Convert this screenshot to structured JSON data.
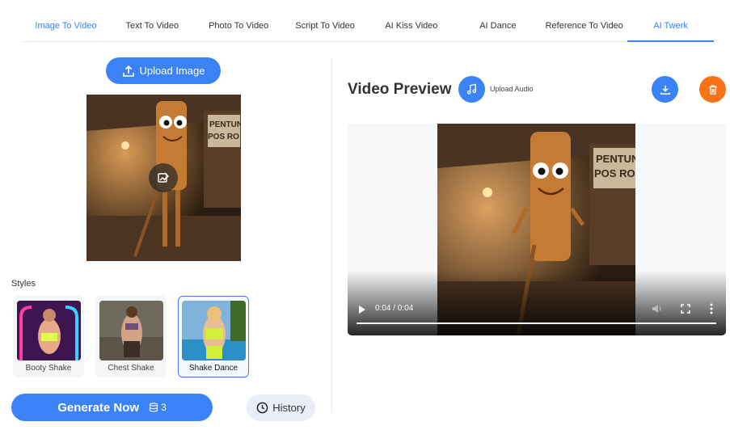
{
  "tabs": [
    {
      "label": "Image To Video",
      "state": "active"
    },
    {
      "label": "Text To Video",
      "state": ""
    },
    {
      "label": "Photo To Video",
      "state": ""
    },
    {
      "label": "Script To Video",
      "state": ""
    },
    {
      "label": "AI Kiss Video",
      "state": ""
    },
    {
      "label": "AI Dance",
      "state": ""
    },
    {
      "label": "Reference To Video",
      "state": ""
    },
    {
      "label": "AI Twerk",
      "state": "selected"
    }
  ],
  "upload": {
    "label": "Upload Image",
    "icon": "upload-icon"
  },
  "styles": {
    "label": "Styles",
    "items": [
      {
        "name": "Booty Shake",
        "selected": false
      },
      {
        "name": "Chest Shake",
        "selected": false
      },
      {
        "name": "Shake Dance",
        "selected": true
      }
    ]
  },
  "generate": {
    "label": "Generate Now",
    "credits": "3",
    "icon": "coin-stack-icon"
  },
  "history": {
    "label": "History",
    "icon": "clock-icon"
  },
  "preview": {
    "title": "Video Preview",
    "upload_audio_label": "Upload Audio",
    "audio_icon": "music-note-icon",
    "download_icon": "download-icon",
    "delete_icon": "trash-icon"
  },
  "video": {
    "time": "0:04 / 0:04",
    "progress": 1.0
  },
  "colors": {
    "accent": "#3b82f6",
    "delete": "#f97316"
  }
}
